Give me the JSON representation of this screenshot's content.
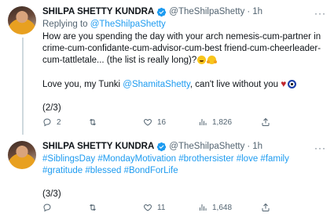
{
  "tweet1": {
    "author_name": "SHILPA SHETTY KUNDRA",
    "handle": "@TheShilpaShetty",
    "separator": "·",
    "time": "1h",
    "reply_prefix": "Replying to ",
    "reply_to": "@TheShilpaShetty",
    "text_line1": "How are you spending the day with your arch nemesis-cum-partner in crime-cum-confidante-cum-advisor-cum-best friend-cum-cheerleader-cum-tattletale... (the list is really long)?",
    "text_line2_prefix": "Love you, my Tunki ",
    "text_line2_mention": "@ShamitaShetty",
    "text_line2_suffix": ", can't live without you ",
    "heart": "♥",
    "thread_marker": "(2/3)",
    "replies": "2",
    "retweets": "",
    "likes": "16",
    "views": "1,826"
  },
  "tweet2": {
    "author_name": "SHILPA SHETTY KUNDRA",
    "handle": "@TheShilpaShetty",
    "separator": "·",
    "time": "1h",
    "hashtags_line1": "#SiblingsDay #MondayMotivation #brothersister #love #family",
    "hashtags_line2": "#gratitude #blessed #BondForLife",
    "thread_marker": "(3/3)",
    "replies": "",
    "retweets": "",
    "likes": "11",
    "views": "1,648"
  },
  "more_glyph": "···"
}
